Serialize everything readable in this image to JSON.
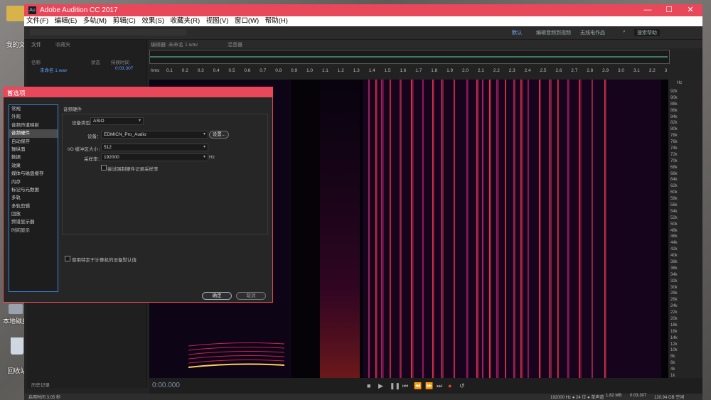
{
  "desktop": {
    "icons": [
      {
        "label": "我的文"
      },
      {
        "label": "本地磁盘"
      },
      {
        "label": "回收站"
      }
    ]
  },
  "window": {
    "title": "Adobe Audition CC 2017",
    "minimize": "—",
    "maximize": "☐",
    "close": "✕",
    "extra": "□"
  },
  "menu": [
    "文件(F)",
    "编辑(E)",
    "多轨(M)",
    "剪辑(C)",
    "效果(S)",
    "收藏夹(R)",
    "视图(V)",
    "窗口(W)",
    "帮助(H)"
  ],
  "toolbar": {
    "workspaces": [
      "默认",
      "编辑音频到视频",
      "无线电作品"
    ],
    "search_placeholder": "搜索帮助"
  },
  "files_panel": {
    "tabs": [
      "文件",
      "收藏夹"
    ],
    "columns": [
      "名称",
      "状态",
      "持续时间"
    ],
    "file": {
      "name": "未命名 1.wav",
      "duration": "0:03.307"
    },
    "footer": "历史记录"
  },
  "editor": {
    "tabs": [
      "编辑器: 未命名 1.wav",
      "混音器"
    ],
    "ruler_ticks": [
      "hms",
      "0.1",
      "0.2",
      "0.3",
      "0.4",
      "0.5",
      "0.6",
      "0.7",
      "0.8",
      "0.9",
      "1.0",
      "1.1",
      "1.2",
      "1.3",
      "1.4",
      "1.5",
      "1.6",
      "1.7",
      "1.8",
      "1.9",
      "2.0",
      "2.1",
      "2.2",
      "2.3",
      "2.4",
      "2.5",
      "2.6",
      "2.7",
      "2.8",
      "2.9",
      "3.0",
      "3.1",
      "3.2",
      "3"
    ],
    "hz_unit": "Hz",
    "hz_labels": [
      "92k",
      "90k",
      "88k",
      "86k",
      "84k",
      "82k",
      "80k",
      "78k",
      "76k",
      "74k",
      "72k",
      "70k",
      "68k",
      "66k",
      "64k",
      "62k",
      "60k",
      "58k",
      "56k",
      "54k",
      "52k",
      "50k",
      "48k",
      "46k",
      "44k",
      "42k",
      "40k",
      "38k",
      "36k",
      "34k",
      "32k",
      "30k",
      "28k",
      "26k",
      "24k",
      "22k",
      "20k",
      "18k",
      "16k",
      "14k",
      "12k",
      "10k",
      "8k",
      "6k",
      "4k",
      "1k"
    ],
    "timecode": "0:00.000"
  },
  "statusbar": {
    "left": "启用时间 3.05 秒",
    "format": "192000 Hz ● 24 位 ● 单声道",
    "size": "1.82 MB",
    "duration": "0:03.307",
    "free": "120.94 GB 空闲"
  },
  "dialog": {
    "title": "首选项",
    "categories": [
      "常规",
      "外观",
      "音频声道映射",
      "音频硬件",
      "自动保存",
      "操纵面",
      "数据",
      "效果",
      "媒体与磁盘缓存",
      "内存",
      "标记与元数据",
      "多轨",
      "多轨剪辑",
      "回放",
      "频谱显示器",
      "时间显示"
    ],
    "selected_index": 3,
    "section_title": "音频硬件",
    "device_type_label": "设备类型：",
    "device_type_value": "ASIO",
    "device_label": "设备：",
    "device_value": "EDMICN_Pro_Audio",
    "settings_button": "设置...",
    "buffer_label": "I/O 缓冲区大小：",
    "buffer_value": "512",
    "samplerate_label": "采样率：",
    "samplerate_value": "192000",
    "samplerate_unit": "Hz",
    "force_checkbox_label": "尝试强制硬件记录采样率",
    "default_checkbox_label": "使用特定于计算机的设备默认值",
    "ok_button": "确定",
    "cancel_button": "取消"
  }
}
